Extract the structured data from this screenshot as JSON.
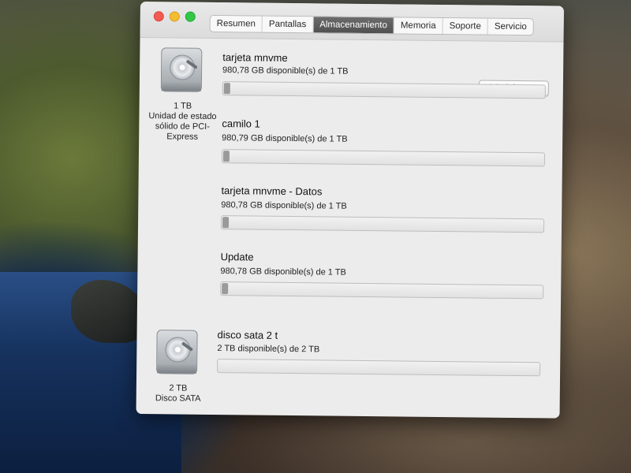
{
  "tabs": [
    {
      "label": "Resumen"
    },
    {
      "label": "Pantallas"
    },
    {
      "label": "Almacenamiento",
      "active": true
    },
    {
      "label": "Memoria"
    },
    {
      "label": "Soporte"
    },
    {
      "label": "Servicio"
    }
  ],
  "drives": [
    {
      "icon": "hard-drive-icon",
      "capacity_label": "1 TB",
      "type_label": "Unidad de estado sólido de PCI-Express"
    },
    {
      "icon": "hard-drive-icon",
      "capacity_label": "2 TB",
      "type_label": "Disco SATA"
    }
  ],
  "volumes": [
    {
      "name": "tarjeta mnvme",
      "available": "980,78 GB disponible(s) de 1 TB",
      "used_fraction": 0.02
    },
    {
      "name": "camilo 1",
      "available": "980,79 GB disponible(s) de 1 TB",
      "used_fraction": 0.02
    },
    {
      "name": "tarjeta mnvme - Datos",
      "available": "980,78 GB disponible(s) de 1 TB",
      "used_fraction": 0.02
    },
    {
      "name": "Update",
      "available": "980,78 GB disponible(s) de 1 TB",
      "used_fraction": 0.02
    },
    {
      "name": "disco sata 2 t",
      "available": "2 TB disponible(s) de 2 TB",
      "used_fraction": 0.0
    }
  ],
  "manage_button_label": "Administrar..."
}
